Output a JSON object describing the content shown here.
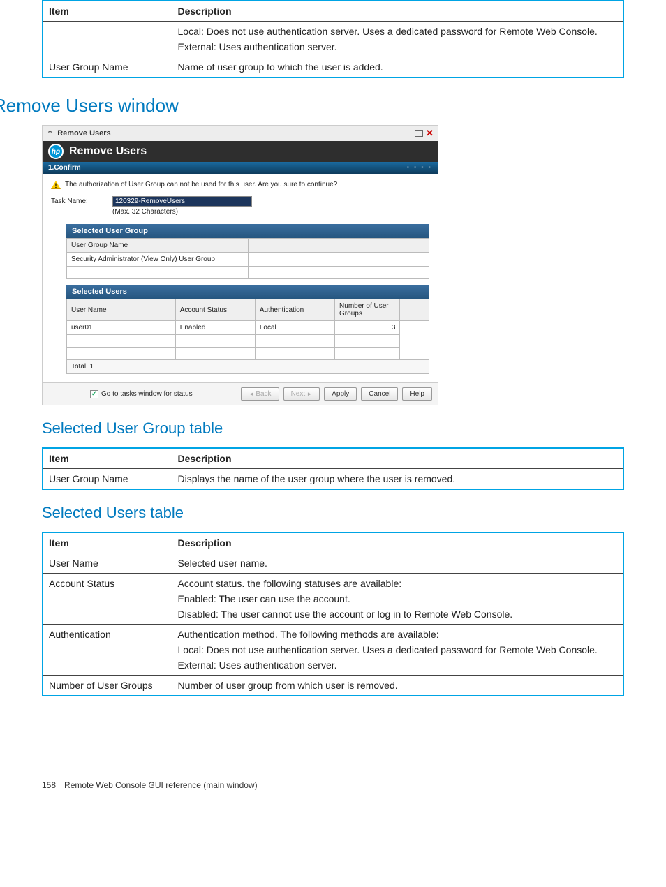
{
  "table1": {
    "head_item": "Item",
    "head_desc": "Description",
    "r1_item": "",
    "r1_p1": "Local: Does not use authentication server. Uses a dedicated password for Remote Web Console.",
    "r1_p2": "External: Uses authentication server.",
    "r2_item": "User Group Name",
    "r2_desc": "Name of user group to which the user is added."
  },
  "h1": "Remove Users window",
  "shot": {
    "window_title": "Remove Users",
    "banner_title": "Remove Users",
    "step": "1.Confirm",
    "warning": "The authorization of User Group can not be used for this user. Are you sure to continue?",
    "task_label": "Task Name:",
    "task_value": "120329-RemoveUsers",
    "task_hint": "(Max. 32 Characters)",
    "sug": {
      "head": "Selected User Group",
      "col1": "User Group Name",
      "val1": "Security Administrator (View Only) User Group"
    },
    "su": {
      "head": "Selected Users",
      "th1": "User Name",
      "th2": "Account Status",
      "th3": "Authentication",
      "th4": "Number of User Groups",
      "r_user": "user01",
      "r_status": "Enabled",
      "r_auth": "Local",
      "r_num": "3",
      "total": "Total:  1"
    },
    "chk_label": "Go to tasks window for status",
    "btn_back": "Back",
    "btn_next": "Next",
    "btn_apply": "Apply",
    "btn_cancel": "Cancel",
    "btn_help": "Help"
  },
  "h2a": "Selected User Group table",
  "table2": {
    "head_item": "Item",
    "head_desc": "Description",
    "r1_item": "User Group Name",
    "r1_desc": "Displays the name of the user group where the user is removed."
  },
  "h2b": "Selected Users table",
  "table3": {
    "head_item": "Item",
    "head_desc": "Description",
    "r1_item": "User Name",
    "r1_desc": "Selected user name.",
    "r2_item": "Account Status",
    "r2_p1": "Account status. the following statuses are available:",
    "r2_p2": "Enabled: The user can use the account.",
    "r2_p3": "Disabled: The user cannot use the account or log in to Remote Web Console.",
    "r3_item": "Authentication",
    "r3_p1": "Authentication method. The following methods are available:",
    "r3_p2": "Local: Does not use authentication server. Uses a dedicated password for Remote Web Console.",
    "r3_p3": "External: Uses authentication server.",
    "r4_item": "Number of User Groups",
    "r4_desc": "Number of user group from which user is removed."
  },
  "footer": {
    "page": "158",
    "text": "Remote Web Console GUI reference (main window)"
  }
}
